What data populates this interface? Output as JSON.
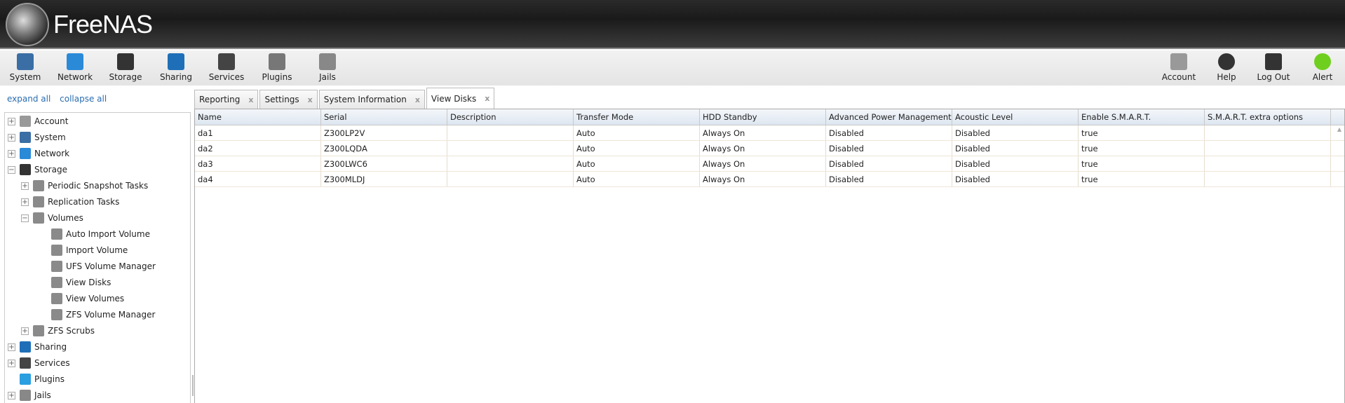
{
  "app": {
    "title": "FreeNAS"
  },
  "toolbar": {
    "left": [
      "System",
      "Network",
      "Storage",
      "Sharing",
      "Services",
      "Plugins",
      "Jails"
    ],
    "right": [
      "Account",
      "Help",
      "Log Out",
      "Alert"
    ]
  },
  "sidebar": {
    "expand_all": "expand all",
    "collapse_all": "collapse all",
    "tree": [
      {
        "label": "Account",
        "level": 0,
        "toggle": "+",
        "icon": "account-icon"
      },
      {
        "label": "System",
        "level": 0,
        "toggle": "+",
        "icon": "system-icon"
      },
      {
        "label": "Network",
        "level": 0,
        "toggle": "+",
        "icon": "network-icon"
      },
      {
        "label": "Storage",
        "level": 0,
        "toggle": "-",
        "icon": "storage-icon"
      },
      {
        "label": "Periodic Snapshot Tasks",
        "level": 1,
        "toggle": "+",
        "icon": "snapshot-icon"
      },
      {
        "label": "Replication Tasks",
        "level": 1,
        "toggle": "+",
        "icon": "replication-icon"
      },
      {
        "label": "Volumes",
        "level": 1,
        "toggle": "-",
        "icon": "volumes-icon"
      },
      {
        "label": "Auto Import Volume",
        "level": 2,
        "toggle": "",
        "icon": "import-icon"
      },
      {
        "label": "Import Volume",
        "level": 2,
        "toggle": "",
        "icon": "import-icon"
      },
      {
        "label": "UFS Volume Manager",
        "level": 2,
        "toggle": "",
        "icon": "volume-manager-icon"
      },
      {
        "label": "View Disks",
        "level": 2,
        "toggle": "",
        "icon": "view-icon"
      },
      {
        "label": "View Volumes",
        "level": 2,
        "toggle": "",
        "icon": "view-icon"
      },
      {
        "label": "ZFS Volume Manager",
        "level": 2,
        "toggle": "",
        "icon": "volume-manager-icon"
      },
      {
        "label": "ZFS Scrubs",
        "level": 1,
        "toggle": "+",
        "icon": "calendar-icon"
      },
      {
        "label": "Sharing",
        "level": 0,
        "toggle": "+",
        "icon": "sharing-icon"
      },
      {
        "label": "Services",
        "level": 0,
        "toggle": "+",
        "icon": "services-icon"
      },
      {
        "label": "Plugins",
        "level": 0,
        "toggle": "",
        "icon": "plugins-icon"
      },
      {
        "label": "Jails",
        "level": 0,
        "toggle": "+",
        "icon": "jails-icon"
      }
    ]
  },
  "tabs": [
    {
      "label": "Reporting",
      "close": "x"
    },
    {
      "label": "Settings",
      "close": "x"
    },
    {
      "label": "System Information",
      "close": "x"
    },
    {
      "label": "View Disks",
      "close": "x",
      "active": true
    }
  ],
  "table": {
    "columns": [
      "Name",
      "Serial",
      "Description",
      "Transfer Mode",
      "HDD Standby",
      "Advanced Power Management",
      "Acoustic Level",
      "Enable S.M.A.R.T.",
      "S.M.A.R.T. extra options"
    ],
    "rows": [
      [
        "da1",
        "Z300LP2V",
        "",
        "Auto",
        "Always On",
        "Disabled",
        "Disabled",
        "true",
        ""
      ],
      [
        "da2",
        "Z300LQDA",
        "",
        "Auto",
        "Always On",
        "Disabled",
        "Disabled",
        "true",
        ""
      ],
      [
        "da3",
        "Z300LWC6",
        "",
        "Auto",
        "Always On",
        "Disabled",
        "Disabled",
        "true",
        ""
      ],
      [
        "da4",
        "Z300MLDJ",
        "",
        "Auto",
        "Always On",
        "Disabled",
        "Disabled",
        "true",
        ""
      ]
    ]
  },
  "colors": {
    "link": "#2a6db0",
    "alert": "#6fcf1f"
  }
}
